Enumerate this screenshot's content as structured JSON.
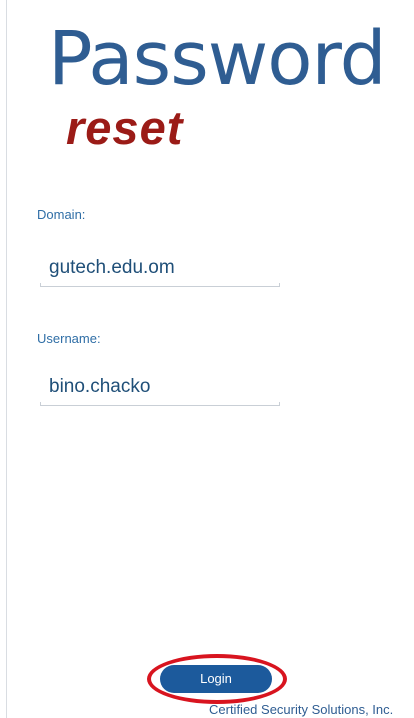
{
  "header": {
    "title_main": "Password",
    "title_sub": "reset"
  },
  "form": {
    "domain": {
      "label": "Domain:",
      "value": "gutech.edu.om"
    },
    "username": {
      "label": "Username:",
      "value": "bino.chacko"
    },
    "login_label": "Login"
  },
  "footer": {
    "text": "Certified Security Solutions, Inc."
  },
  "colors": {
    "title_blue": "#2f5d92",
    "reset_red": "#9b1b17",
    "button_blue": "#1c5a9c",
    "highlight_red": "#d8141f"
  }
}
